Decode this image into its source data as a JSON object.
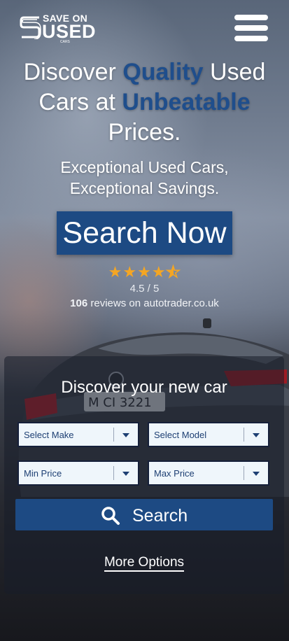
{
  "brand": {
    "line1": "SAVE ON",
    "line2": "USED",
    "line3": "CARS"
  },
  "header": {
    "menu_icon": "hamburger-menu-icon"
  },
  "hero": {
    "headline": {
      "part1": "Discover ",
      "accent1": "Quality",
      "part2": " Used Cars at ",
      "accent2": "Unbeatable",
      "part3": " Prices."
    },
    "subheadline": "Exceptional Used Cars, Exceptional Savings.",
    "cta_label": "Search Now"
  },
  "rating": {
    "stars": 4.5,
    "score_text": "4.5 / 5",
    "review_count": "106",
    "reviews_suffix": " reviews on autotrader.co.uk"
  },
  "search_panel": {
    "title": "Discover your new car",
    "make_placeholder": "Select Make",
    "model_placeholder": "Select Model",
    "min_price_placeholder": "Min Price",
    "max_price_placeholder": "Max Price",
    "search_label": "Search",
    "more_options_label": "More Options"
  },
  "colors": {
    "accent_blue": "#1d4a83",
    "star_gold": "#f5a623"
  }
}
